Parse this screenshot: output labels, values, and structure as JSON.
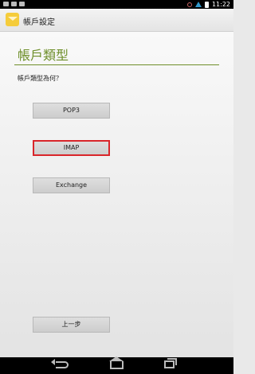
{
  "status_bar": {
    "time": "11:22",
    "icons": [
      "notification-icon",
      "gallery-icon",
      "play-icon",
      "alarm-icon",
      "wifi-icon",
      "battery-icon"
    ]
  },
  "action_bar": {
    "title": "帳戶設定",
    "icon": "email-icon"
  },
  "page": {
    "title": "帳戶類型",
    "question": "帳戶類型為何？"
  },
  "buttons": {
    "pop3": "POP3",
    "imap": "IMAP",
    "exchange": "Exchange",
    "previous": "上一步"
  },
  "highlight_color": "#d9252a",
  "accent_color": "#6e8f2a"
}
